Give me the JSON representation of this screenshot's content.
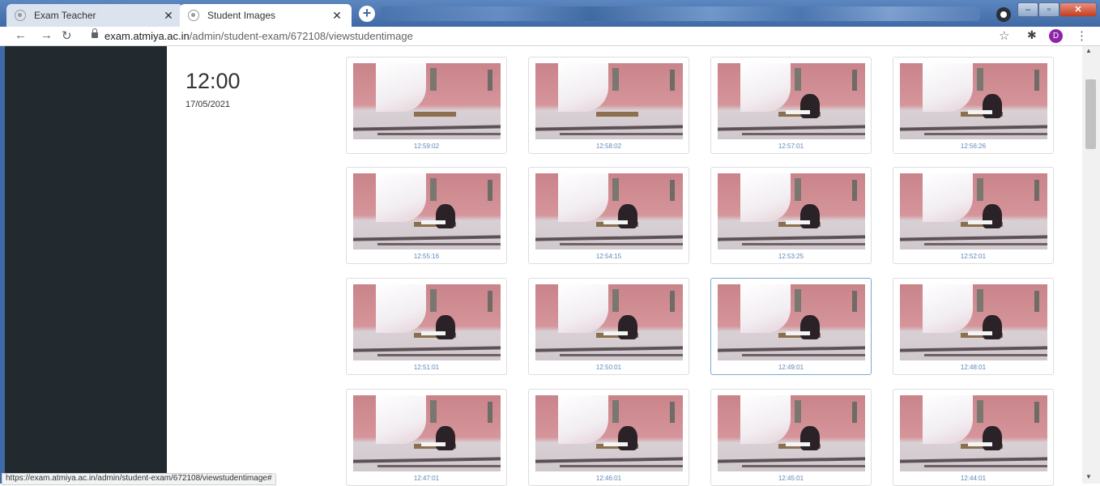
{
  "browser": {
    "tabs": [
      {
        "title": "Exam Teacher",
        "active": false
      },
      {
        "title": "Student Images",
        "active": true
      }
    ],
    "url_host": "exam.atmiya.ac.in",
    "url_path": "/admin/student-exam/672108/viewstudentimage",
    "profile_initial": "D",
    "status_url": "https://exam.atmiya.ac.in/admin/student-exam/672108/viewstudentimage#"
  },
  "session": {
    "time": "12:00",
    "date": "17/05/2021"
  },
  "images": [
    {
      "timestamp": "12:59:02"
    },
    {
      "timestamp": "12:58:02"
    },
    {
      "timestamp": "12:57:01"
    },
    {
      "timestamp": "12:56:26"
    },
    {
      "timestamp": "12:55:16"
    },
    {
      "timestamp": "12:54:15"
    },
    {
      "timestamp": "12:53:25"
    },
    {
      "timestamp": "12:52:01"
    },
    {
      "timestamp": "12:51:01"
    },
    {
      "timestamp": "12:50:01"
    },
    {
      "timestamp": "12:49:01"
    },
    {
      "timestamp": "12:48:01"
    },
    {
      "timestamp": "12:47:01"
    },
    {
      "timestamp": "12:46:01"
    },
    {
      "timestamp": "12:45:01"
    },
    {
      "timestamp": "12:44:01"
    }
  ],
  "colors": {
    "sidebar": "#222a30",
    "timestamp_link": "#5f88b8",
    "selected_border": "#7aa7d0"
  }
}
